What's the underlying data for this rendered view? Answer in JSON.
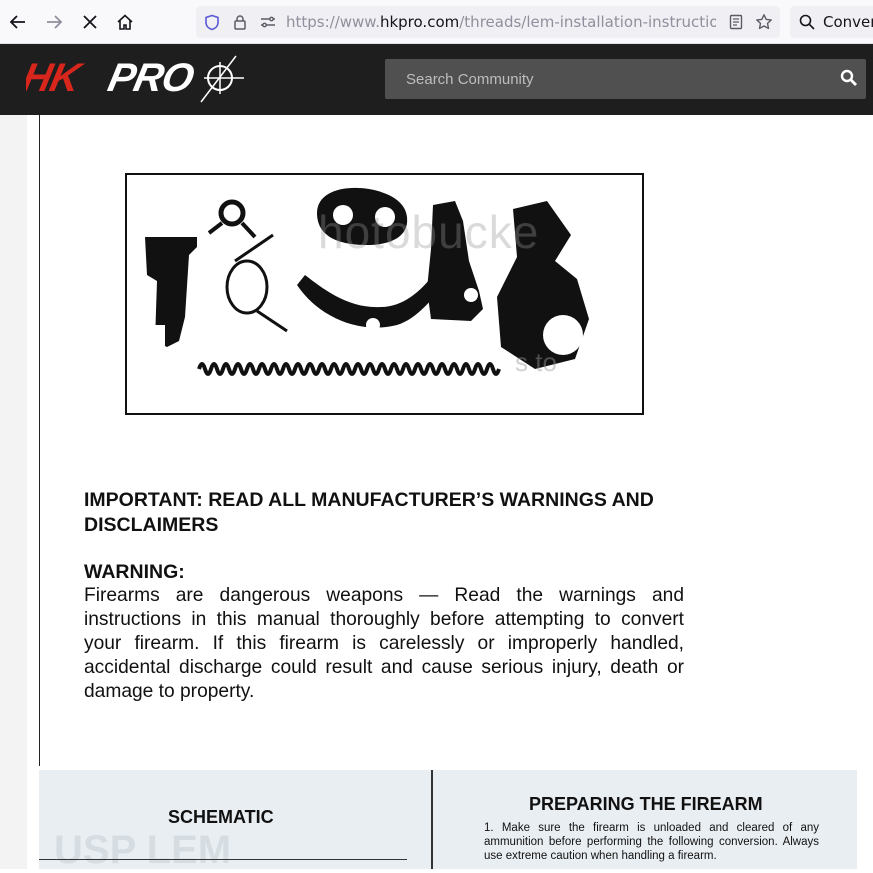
{
  "browser": {
    "url_prefix": "https://www.",
    "url_host": "hkpro.com",
    "url_path": "/threads/lem-installation-instructions.",
    "search_label": "Conver"
  },
  "site": {
    "logo_text": "HKPRO",
    "search_placeholder": "Search Community",
    "accent_color": "#d9261c"
  },
  "scan_page1": {
    "watermark": "hotobucke",
    "watermark_fragment": "s to",
    "important": "IMPORTANT: READ ALL MANUFACTURER’S WARNINGS AND DISCLAIMERS",
    "warning_title": "WARNING:",
    "warning_body": "Firearms are dangerous weapons — Read the warnings and instructions in this manual thoroughly before attempting to convert your firearm. If this firearm is carelessly or improperly handled, accidental discharge could result and cause serious injury, death or damage to property."
  },
  "scan_page2": {
    "left_title": "SCHEMATIC",
    "right_title": "PREPARING THE FIREARM",
    "right_body": "1. Make sure the firearm is unloaded and cleared of any ammunition before performing the following conversion. Always use extreme caution when handling a firearm."
  }
}
